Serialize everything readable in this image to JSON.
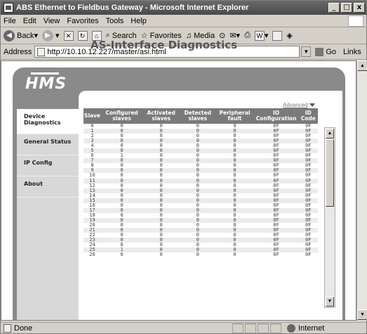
{
  "window": {
    "title": "ABS Ethernet to Fieldbus Gateway - Microsoft Internet Explorer",
    "min": "_",
    "max": "□",
    "close": "x"
  },
  "menu": [
    "File",
    "Edit",
    "View",
    "Favorites",
    "Tools",
    "Help"
  ],
  "toolbar": {
    "back": "Back",
    "search": "Search",
    "favorites": "Favorites",
    "media": "Media"
  },
  "address": {
    "label": "Address",
    "url": "http://10.10.12.227/master/asi.html",
    "go": "Go",
    "links": "Links"
  },
  "status": {
    "text": "Done",
    "zone": "Internet"
  },
  "page": {
    "logo": "HMS",
    "title": "AS-Interface Diagnostics",
    "advanced": "Advanced",
    "nav": [
      {
        "label": "Device Diagnostics",
        "active": true
      },
      {
        "label": "General Status",
        "active": false
      },
      {
        "label": "IP Config",
        "active": false
      },
      {
        "label": "About",
        "active": false
      }
    ],
    "columns": [
      "Slave",
      "Configured slaves",
      "Activated slaves",
      "Detected slaves",
      "Peripheral fault",
      "IO Configuration",
      "ID Code"
    ],
    "rows": [
      [
        "0",
        "0",
        "0",
        "0",
        "0",
        "0F",
        "0F"
      ],
      [
        "1",
        "0",
        "0",
        "0",
        "0",
        "0F",
        "0F"
      ],
      [
        "2",
        "0",
        "0",
        "0",
        "0",
        "0F",
        "0F"
      ],
      [
        "3",
        "0",
        "0",
        "0",
        "0",
        "0F",
        "0F"
      ],
      [
        "4",
        "0",
        "0",
        "0",
        "0",
        "0F",
        "0F"
      ],
      [
        "5",
        "0",
        "0",
        "0",
        "0",
        "0F",
        "0F"
      ],
      [
        "6",
        "1",
        "0",
        "0",
        "0",
        "0F",
        "0F"
      ],
      [
        "7",
        "0",
        "0",
        "0",
        "0",
        "0F",
        "0F"
      ],
      [
        "8",
        "0",
        "0",
        "0",
        "0",
        "0F",
        "0F"
      ],
      [
        "9",
        "0",
        "0",
        "0",
        "0",
        "0F",
        "0F"
      ],
      [
        "10",
        "0",
        "0",
        "0",
        "0",
        "0F",
        "0F"
      ],
      [
        "11",
        "0",
        "0",
        "0",
        "0",
        "0F",
        "0F"
      ],
      [
        "12",
        "0",
        "0",
        "0",
        "0",
        "0F",
        "0F"
      ],
      [
        "13",
        "0",
        "0",
        "0",
        "0",
        "0F",
        "0F"
      ],
      [
        "14",
        "0",
        "0",
        "0",
        "0",
        "0F",
        "0F"
      ],
      [
        "15",
        "0",
        "0",
        "0",
        "0",
        "0F",
        "0F"
      ],
      [
        "16",
        "0",
        "0",
        "0",
        "0",
        "0F",
        "0F"
      ],
      [
        "17",
        "0",
        "0",
        "0",
        "0",
        "0F",
        "0F"
      ],
      [
        "18",
        "0",
        "0",
        "0",
        "0",
        "0F",
        "0F"
      ],
      [
        "19",
        "0",
        "0",
        "0",
        "0",
        "0F",
        "0F"
      ],
      [
        "20",
        "0",
        "0",
        "0",
        "0",
        "0F",
        "0F"
      ],
      [
        "21",
        "0",
        "0",
        "0",
        "0",
        "0F",
        "0F"
      ],
      [
        "22",
        "0",
        "0",
        "0",
        "0",
        "0F",
        "0F"
      ],
      [
        "23",
        "0",
        "0",
        "0",
        "0",
        "0F",
        "0F"
      ],
      [
        "24",
        "0",
        "0",
        "0",
        "0",
        "0F",
        "0F"
      ],
      [
        "25",
        "1",
        "0",
        "0",
        "0",
        "0F",
        "0F"
      ],
      [
        "26",
        "0",
        "0",
        "0",
        "0",
        "0F",
        "0F"
      ]
    ]
  }
}
